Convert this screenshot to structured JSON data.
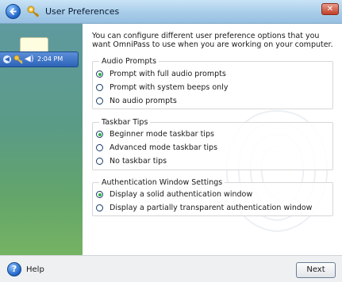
{
  "window": {
    "title": "User Preferences",
    "close_glyph": "✕"
  },
  "tray": {
    "time": "2:04 PM"
  },
  "intro_text": "You can configure different user preference options that you want OmniPass to use when you are working on your computer.",
  "groups": [
    {
      "label": "Audio Prompts",
      "options": [
        {
          "label": "Prompt with full audio prompts",
          "checked": true
        },
        {
          "label": "Prompt with system beeps only",
          "checked": false
        },
        {
          "label": "No audio prompts",
          "checked": false
        }
      ]
    },
    {
      "label": "Taskbar Tips",
      "options": [
        {
          "label": "Beginner mode taskbar tips",
          "checked": true
        },
        {
          "label": "Advanced mode taskbar tips",
          "checked": false
        },
        {
          "label": "No taskbar tips",
          "checked": false
        }
      ]
    },
    {
      "label": "Authentication Window Settings",
      "options": [
        {
          "label": "Display a solid authentication window",
          "checked": true
        },
        {
          "label": "Display a partially transparent authentication window",
          "checked": false
        }
      ]
    }
  ],
  "footer": {
    "help_label": "Help",
    "next_label": "Next"
  },
  "colors": {
    "radio_checked": "#2ab34a",
    "title_bar": "#a8cde9",
    "sidebar_top": "#5f9a9f",
    "sidebar_bottom": "#75b363"
  }
}
